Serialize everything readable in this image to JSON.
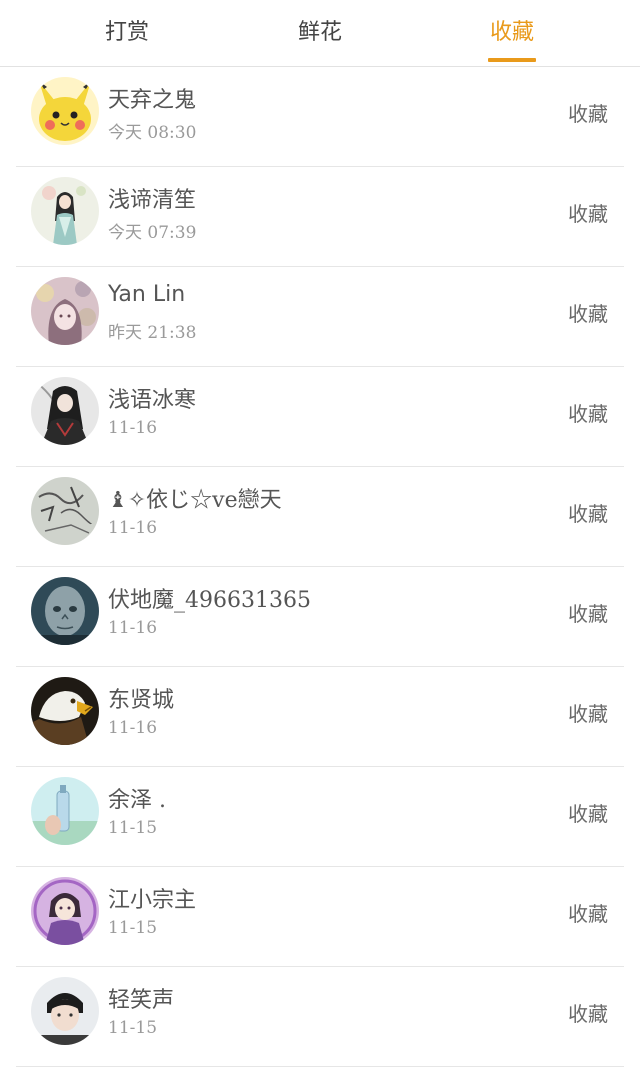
{
  "tabs": [
    {
      "label": "打赏",
      "active": false
    },
    {
      "label": "鲜花",
      "active": false
    },
    {
      "label": "收藏",
      "active": true
    }
  ],
  "accent_color": "#e99a1b",
  "entries": [
    {
      "name": "天弃之鬼",
      "time": "今天 08:30",
      "action": "收藏",
      "avatar": "pikachu"
    },
    {
      "name": "浅谛清笙",
      "time": "今天 07:39",
      "action": "收藏",
      "avatar": "anime-girl-illustration"
    },
    {
      "name": "Yan Lin",
      "time": "昨天 21:38",
      "action": "收藏",
      "avatar": "girl-with-flowers"
    },
    {
      "name": "浅语冰寒",
      "time": "11-16",
      "action": "收藏",
      "avatar": "anime-character-dark-hair"
    },
    {
      "name": "♝✧依じ☆ve戀天",
      "time": "11-16",
      "action": "收藏",
      "avatar": "calligraphy-sketch"
    },
    {
      "name": "伏地魔_496631365",
      "time": "11-16",
      "action": "收藏",
      "avatar": "voldemort"
    },
    {
      "name": "东贤城",
      "time": "11-16",
      "action": "收藏",
      "avatar": "eagle"
    },
    {
      "name": "余泽 .",
      "time": "11-15",
      "action": "收藏",
      "avatar": "bottle-sky"
    },
    {
      "name": "江小宗主",
      "time": "11-15",
      "action": "收藏",
      "avatar": "anime-character-purple"
    },
    {
      "name": "轻笑声",
      "time": "11-15",
      "action": "收藏",
      "avatar": "boy-portrait"
    }
  ]
}
